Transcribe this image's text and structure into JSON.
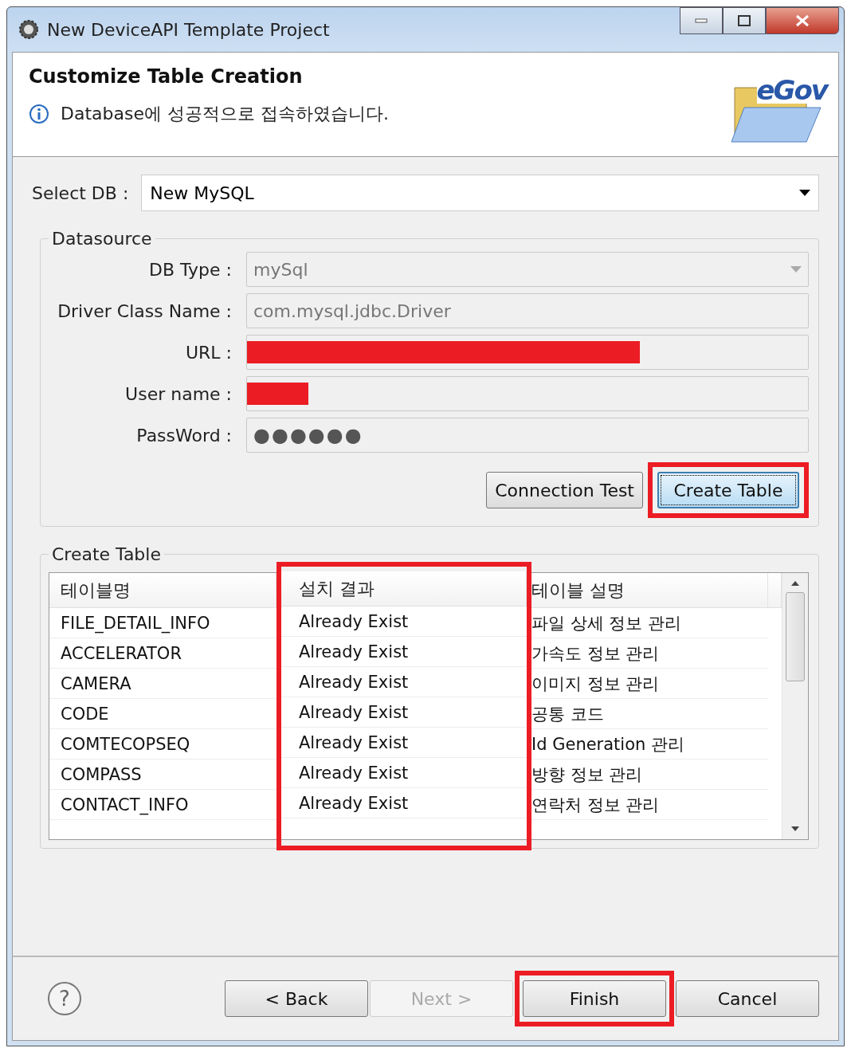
{
  "window": {
    "title": "New DeviceAPI Template Project"
  },
  "header": {
    "title": "Customize Table Creation",
    "message": "Database에 성공적으로 접속하였습니다.",
    "logo": "eGov"
  },
  "select_db": {
    "label": "Select DB :",
    "value": "New MySQL"
  },
  "datasource": {
    "title": "Datasource",
    "fields": [
      {
        "label": "DB Type :",
        "value": "mySql",
        "kind": "combo"
      },
      {
        "label": "Driver Class Name :",
        "value": "com.mysql.jdbc.Driver",
        "kind": "text"
      },
      {
        "label": "URL :",
        "kind": "redacted",
        "level": 0.7
      },
      {
        "label": "User name :",
        "kind": "redacted",
        "level": 0.11
      },
      {
        "label": "PassWord :",
        "value": "●●●●●●",
        "kind": "password"
      }
    ],
    "buttons": [
      {
        "label": "Connection Test",
        "highlighted": false,
        "focused": false
      },
      {
        "label": "Create Table",
        "highlighted": true,
        "focused": true
      }
    ]
  },
  "create_table": {
    "title": "Create Table",
    "columns": [
      {
        "label": "테이블명",
        "highlighted": false
      },
      {
        "label": "설치 결과",
        "highlighted": true
      },
      {
        "label": "테이블 설명",
        "highlighted": false
      }
    ],
    "rows": [
      [
        "FILE_DETAIL_INFO",
        "Already Exist",
        "파일 상세 정보 관리"
      ],
      [
        "ACCELERATOR",
        "Already Exist",
        "가속도 정보 관리"
      ],
      [
        "CAMERA",
        "Already Exist",
        "이미지 정보 관리"
      ],
      [
        "CODE",
        "Already Exist",
        "공통 코드"
      ],
      [
        "COMTECOPSEQ",
        "Already Exist",
        "Id Generation 관리"
      ],
      [
        "COMPASS",
        "Already Exist",
        "방향 정보 관리"
      ],
      [
        "CONTACT_INFO",
        "Already Exist",
        "연락처 정보 관리"
      ]
    ]
  },
  "help": {
    "label": "?"
  },
  "footer_buttons": [
    {
      "label": "< Back",
      "disabled": false,
      "highlighted": false
    },
    {
      "label": "Next >",
      "disabled": true,
      "highlighted": false
    },
    {
      "label": "Finish",
      "disabled": false,
      "highlighted": true
    },
    {
      "label": "Cancel",
      "disabled": false,
      "highlighted": false
    }
  ]
}
